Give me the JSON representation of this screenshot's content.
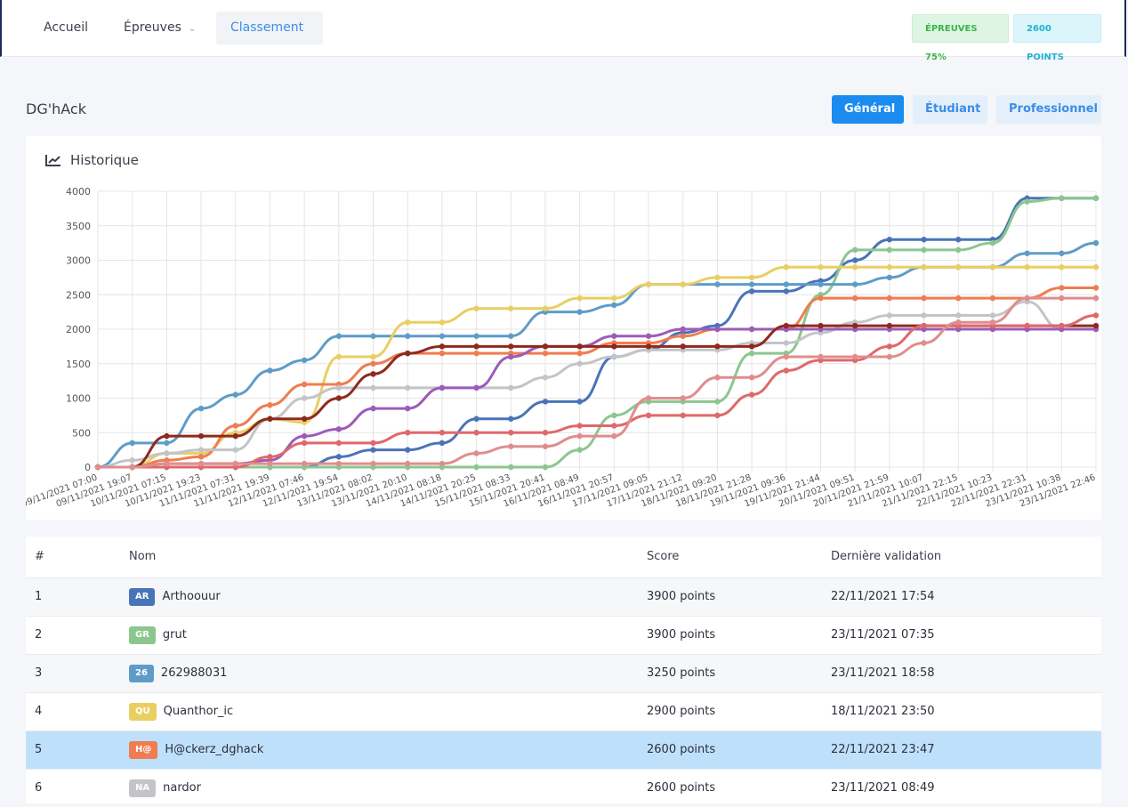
{
  "nav": {
    "items": [
      {
        "label": "Accueil"
      },
      {
        "label": "Épreuves",
        "icon": "chevron-down-icon"
      },
      {
        "label": "Classement"
      }
    ],
    "badges": {
      "epreuves": "ÉPREUVES 75%",
      "points": "2600 POINTS"
    }
  },
  "page": {
    "title": "DG'hAck",
    "filters": [
      "Général",
      "Étudiant",
      "Professionnel"
    ]
  },
  "chart": {
    "title": "Historique",
    "icon": "line-chart-icon"
  },
  "chart_data": {
    "type": "line",
    "categories": [
      "09/11/2021 07:00",
      "09/11/2021 19:07",
      "10/11/2021 07:15",
      "10/11/2021 19:23",
      "11/11/2021 07:31",
      "11/11/2021 19:39",
      "12/11/2021 07:46",
      "12/11/2021 19:54",
      "13/11/2021 08:02",
      "13/11/2021 20:10",
      "14/11/2021 08:18",
      "14/11/2021 20:25",
      "15/11/2021 08:33",
      "15/11/2021 20:41",
      "16/11/2021 08:49",
      "16/11/2021 20:57",
      "17/11/2021 09:05",
      "17/11/2021 21:12",
      "18/11/2021 09:20",
      "18/11/2021 21:28",
      "19/11/2021 09:36",
      "19/11/2021 21:44",
      "20/11/2021 09:51",
      "20/11/2021 21:59",
      "21/11/2021 10:07",
      "21/11/2021 22:15",
      "22/11/2021 10:23",
      "22/11/2021 22:31",
      "23/11/2021 10:38",
      "23/11/2021 22:46"
    ],
    "ylim": [
      0,
      4000
    ],
    "yticks": [
      0,
      500,
      1000,
      1500,
      2000,
      2500,
      3000,
      3500,
      4000
    ],
    "grid": true,
    "series": [
      {
        "name": "Arthoouur",
        "color": "#4a74b8",
        "values": [
          0,
          0,
          0,
          0,
          0,
          0,
          0,
          150,
          250,
          250,
          350,
          700,
          700,
          950,
          950,
          1600,
          1700,
          1950,
          2050,
          2550,
          2550,
          2700,
          3000,
          3300,
          3300,
          3300,
          3300,
          3900,
          3900,
          3900
        ]
      },
      {
        "name": "grut",
        "color": "#8cc68f",
        "values": [
          0,
          0,
          0,
          0,
          0,
          0,
          0,
          0,
          0,
          0,
          0,
          0,
          0,
          0,
          250,
          750,
          950,
          950,
          950,
          1650,
          1650,
          2500,
          3150,
          3150,
          3150,
          3150,
          3250,
          3850,
          3900,
          3900
        ]
      },
      {
        "name": "262988031",
        "color": "#5e9cc8",
        "values": [
          0,
          350,
          350,
          850,
          1050,
          1400,
          1550,
          1900,
          1900,
          1900,
          1900,
          1900,
          1900,
          2250,
          2250,
          2350,
          2650,
          2650,
          2650,
          2650,
          2650,
          2650,
          2650,
          2750,
          2900,
          2900,
          2900,
          3100,
          3100,
          3250
        ]
      },
      {
        "name": "Quanthor_ic",
        "color": "#e9cf62",
        "values": [
          0,
          0,
          200,
          200,
          500,
          700,
          650,
          1600,
          1600,
          2100,
          2100,
          2300,
          2300,
          2300,
          2450,
          2450,
          2650,
          2650,
          2750,
          2750,
          2900,
          2900,
          2900,
          2900,
          2900,
          2900,
          2900,
          2900,
          2900,
          2900
        ]
      },
      {
        "name": "H@ckerz_dghack",
        "color": "#ef7d50",
        "values": [
          0,
          0,
          100,
          150,
          600,
          900,
          1200,
          1200,
          1500,
          1650,
          1650,
          1650,
          1650,
          1650,
          1650,
          1800,
          1800,
          1900,
          2000,
          2000,
          2000,
          2450,
          2450,
          2450,
          2450,
          2450,
          2450,
          2450,
          2600,
          2600
        ]
      },
      {
        "name": "nardor",
        "color": "#c2c4c8",
        "values": [
          0,
          100,
          200,
          250,
          250,
          700,
          1000,
          1150,
          1150,
          1150,
          1150,
          1150,
          1150,
          1300,
          1500,
          1600,
          1700,
          1700,
          1700,
          1800,
          1800,
          1950,
          2100,
          2200,
          2200,
          2200,
          2200,
          2400,
          2000,
          2000
        ]
      },
      {
        "name": "",
        "color": "#9c5cb8",
        "values": [
          0,
          0,
          50,
          50,
          50,
          100,
          450,
          550,
          850,
          850,
          1150,
          1150,
          1600,
          1750,
          1750,
          1900,
          1900,
          2000,
          2000,
          2000,
          2000,
          2000,
          2000,
          2000,
          2000,
          2000,
          2000,
          2000,
          2000,
          2000
        ]
      },
      {
        "name": "",
        "color": "#8e2a1c",
        "values": [
          0,
          0,
          450,
          450,
          450,
          700,
          700,
          1000,
          1350,
          1650,
          1750,
          1750,
          1750,
          1750,
          1750,
          1750,
          1750,
          1750,
          1750,
          1750,
          2050,
          2050,
          2050,
          2050,
          2050,
          2050,
          2050,
          2050,
          2050,
          2050
        ]
      },
      {
        "name": "",
        "color": "#e0686b",
        "values": [
          0,
          0,
          0,
          0,
          0,
          150,
          350,
          350,
          350,
          500,
          500,
          500,
          500,
          500,
          600,
          600,
          750,
          750,
          750,
          1050,
          1400,
          1550,
          1550,
          1750,
          2050,
          2050,
          2050,
          2050,
          2050,
          2200
        ]
      },
      {
        "name": "",
        "color": "#e08d8d",
        "values": [
          0,
          0,
          50,
          50,
          50,
          50,
          50,
          50,
          50,
          50,
          50,
          200,
          300,
          300,
          450,
          450,
          1000,
          1000,
          1300,
          1300,
          1600,
          1600,
          1600,
          1600,
          1800,
          2100,
          2100,
          2450,
          2450,
          2450
        ]
      }
    ]
  },
  "table": {
    "headers": [
      "#",
      "Nom",
      "Score",
      "Dernière validation"
    ],
    "rows": [
      {
        "rank": "1",
        "initials": "AR",
        "color": "#4a74b8",
        "name": "Arthoouur",
        "score": "3900 points",
        "date": "22/11/2021 17:54"
      },
      {
        "rank": "2",
        "initials": "GR",
        "color": "#8cc68f",
        "name": "grut",
        "score": "3900 points",
        "date": "23/11/2021 07:35"
      },
      {
        "rank": "3",
        "initials": "26",
        "color": "#5e9cc8",
        "name": "262988031",
        "score": "3250 points",
        "date": "23/11/2021 18:58"
      },
      {
        "rank": "4",
        "initials": "QU",
        "color": "#e9cf62",
        "name": "Quanthor_ic",
        "score": "2900 points",
        "date": "18/11/2021 23:50"
      },
      {
        "rank": "5",
        "initials": "H@",
        "color": "#ef7d50",
        "name": "H@ckerz_dghack",
        "score": "2600 points",
        "date": "22/11/2021 23:47"
      },
      {
        "rank": "6",
        "initials": "NA",
        "color": "#c2c4c8",
        "name": "nardor",
        "score": "2600 points",
        "date": "23/11/2021 08:49"
      }
    ]
  }
}
